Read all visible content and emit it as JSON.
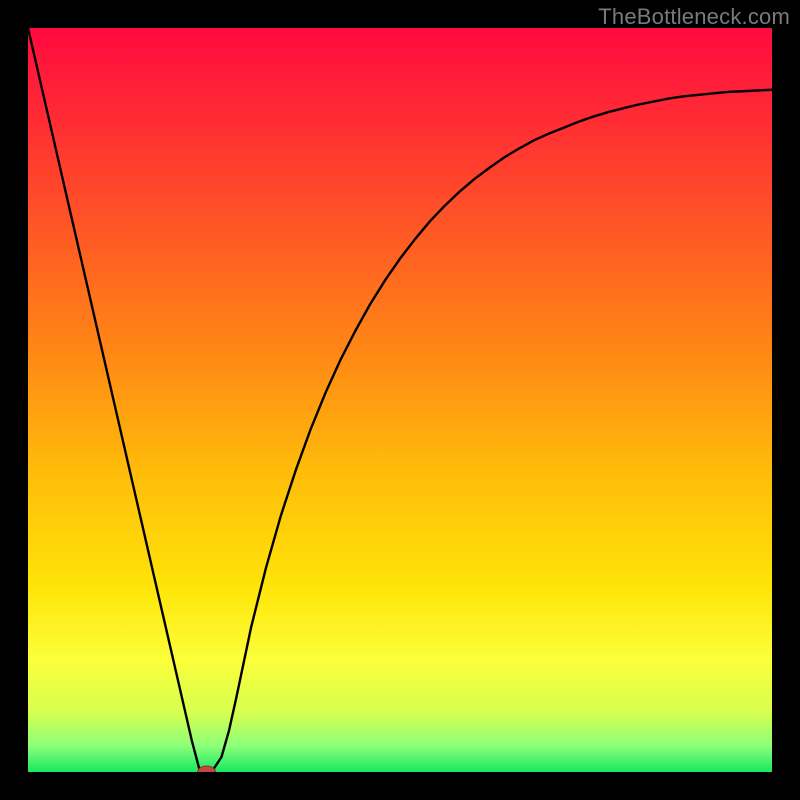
{
  "watermark": "TheBottleneck.com",
  "colors": {
    "frame": "#000000",
    "gradient_stops": [
      {
        "offset": 0.0,
        "color": "#ff0a3f"
      },
      {
        "offset": 0.12,
        "color": "#ff2b34"
      },
      {
        "offset": 0.28,
        "color": "#ff5a24"
      },
      {
        "offset": 0.45,
        "color": "#ff8c14"
      },
      {
        "offset": 0.6,
        "color": "#ffbd0a"
      },
      {
        "offset": 0.75,
        "color": "#ffe408"
      },
      {
        "offset": 0.85,
        "color": "#fbff3a"
      },
      {
        "offset": 0.92,
        "color": "#d6ff4e"
      },
      {
        "offset": 0.965,
        "color": "#8cff7a"
      },
      {
        "offset": 1.0,
        "color": "#18e860"
      }
    ],
    "curve": "#000000",
    "marker_fill": "#c1493f",
    "marker_stroke": "#8d2f28"
  },
  "chart_data": {
    "type": "line",
    "title": "",
    "xlabel": "",
    "ylabel": "",
    "xlim": [
      0,
      100
    ],
    "ylim": [
      0,
      100
    ],
    "grid": false,
    "legend": false,
    "x": [
      0,
      2,
      4,
      6,
      8,
      10,
      12,
      14,
      16,
      18,
      20,
      22,
      23,
      24,
      25,
      26,
      27,
      28,
      30,
      32,
      34,
      36,
      38,
      40,
      42,
      44,
      46,
      48,
      50,
      52,
      54,
      56,
      58,
      60,
      62,
      64,
      66,
      68,
      70,
      72,
      74,
      76,
      78,
      80,
      82,
      84,
      86,
      88,
      90,
      92,
      94,
      96,
      98,
      100
    ],
    "y": [
      100.0,
      91.3,
      82.6,
      73.9,
      65.2,
      56.5,
      47.8,
      39.1,
      30.4,
      21.7,
      13.0,
      4.3,
      0.5,
      0.0,
      0.5,
      2.0,
      5.5,
      10.0,
      19.5,
      27.5,
      34.5,
      40.6,
      46.1,
      51.0,
      55.4,
      59.3,
      62.9,
      66.1,
      69.0,
      71.6,
      74.0,
      76.1,
      78.0,
      79.7,
      81.2,
      82.6,
      83.8,
      84.9,
      85.8,
      86.6,
      87.4,
      88.1,
      88.7,
      89.2,
      89.7,
      90.1,
      90.5,
      90.8,
      91.0,
      91.2,
      91.4,
      91.5,
      91.6,
      91.7
    ],
    "marker": {
      "x": 24,
      "y": 0,
      "rx": 1.2,
      "ry": 0.8
    }
  }
}
